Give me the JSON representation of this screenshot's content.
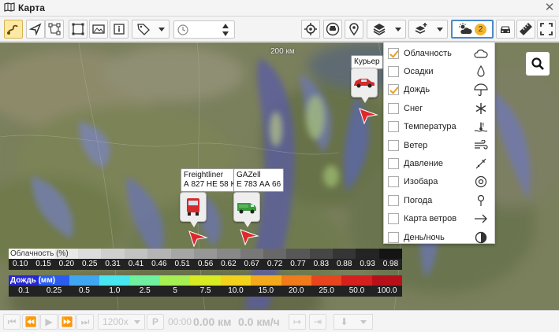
{
  "window": {
    "title": "Карта"
  },
  "map": {
    "scale_label": "200 км"
  },
  "vehicles": [
    {
      "name": "Курьер",
      "plate": ""
    },
    {
      "name": "Freightliner",
      "plate": "А 827 НЕ 58 К:"
    },
    {
      "name": "GAZell",
      "plate": "Е 783 АА 66"
    }
  ],
  "toolbar": {
    "weather_badge": "2",
    "time_value": ""
  },
  "weather_menu": {
    "items": [
      {
        "label": "Облачность",
        "checked": true,
        "icon": "cloud-icon"
      },
      {
        "label": "Осадки",
        "checked": false,
        "icon": "drop-icon"
      },
      {
        "label": "Дождь",
        "checked": true,
        "icon": "umbrella-icon"
      },
      {
        "label": "Снег",
        "checked": false,
        "icon": "snowflake-icon"
      },
      {
        "label": "Температура",
        "checked": false,
        "icon": "thermometer-icon"
      },
      {
        "label": "Ветер",
        "checked": false,
        "icon": "wind-icon"
      },
      {
        "label": "Давление",
        "checked": false,
        "icon": "pressure-icon"
      },
      {
        "label": "Изобара",
        "checked": false,
        "icon": "isobar-icon"
      },
      {
        "label": "Погода",
        "checked": false,
        "icon": "pin-icon"
      },
      {
        "label": "Карта ветров",
        "checked": false,
        "icon": "arrow-right-icon"
      },
      {
        "label": "День/ночь",
        "checked": false,
        "icon": "day-night-icon"
      }
    ]
  },
  "legend_clouds": {
    "title": "Облачность (%)",
    "values": [
      "0.10",
      "0.15",
      "0.20",
      "0.25",
      "0.31",
      "0.41",
      "0.46",
      "0.51",
      "0.56",
      "0.62",
      "0.67",
      "0.72",
      "0.77",
      "0.83",
      "0.88",
      "0.93",
      "0.98"
    ],
    "colors": [
      "#ffffff",
      "#f4f4f4",
      "#e8e8e8",
      "#dcdcdc",
      "#cfcfcf",
      "#c2c2c2",
      "#b4b4b4",
      "#a6a6a6",
      "#979797",
      "#888888",
      "#787878",
      "#686868",
      "#575757",
      "#464646",
      "#353535",
      "#242424",
      "#141414"
    ]
  },
  "legend_rain": {
    "title": "Дождь (мм)",
    "values": [
      "0.1",
      "0.25",
      "0.5",
      "1.0",
      "2.5",
      "5",
      "7.5",
      "10.0",
      "15.0",
      "20.0",
      "25.0",
      "50.0",
      "100.0"
    ],
    "colors": [
      "#2727d6",
      "#2a5cf0",
      "#3fa6f2",
      "#48e6ef",
      "#6ff0a0",
      "#a6ef52",
      "#d8ea20",
      "#f3d21c",
      "#f3a91c",
      "#f07a1c",
      "#e8441e",
      "#d6201e",
      "#b8101a"
    ]
  },
  "player": {
    "speed": "1200x",
    "p_label": "P",
    "time": "00:00",
    "distance": "0.00 км",
    "velocity": "0.0 км/ч"
  },
  "colors": {
    "accent": "#4a89c8",
    "check": "#e8a020",
    "marker": "#e0282c"
  }
}
